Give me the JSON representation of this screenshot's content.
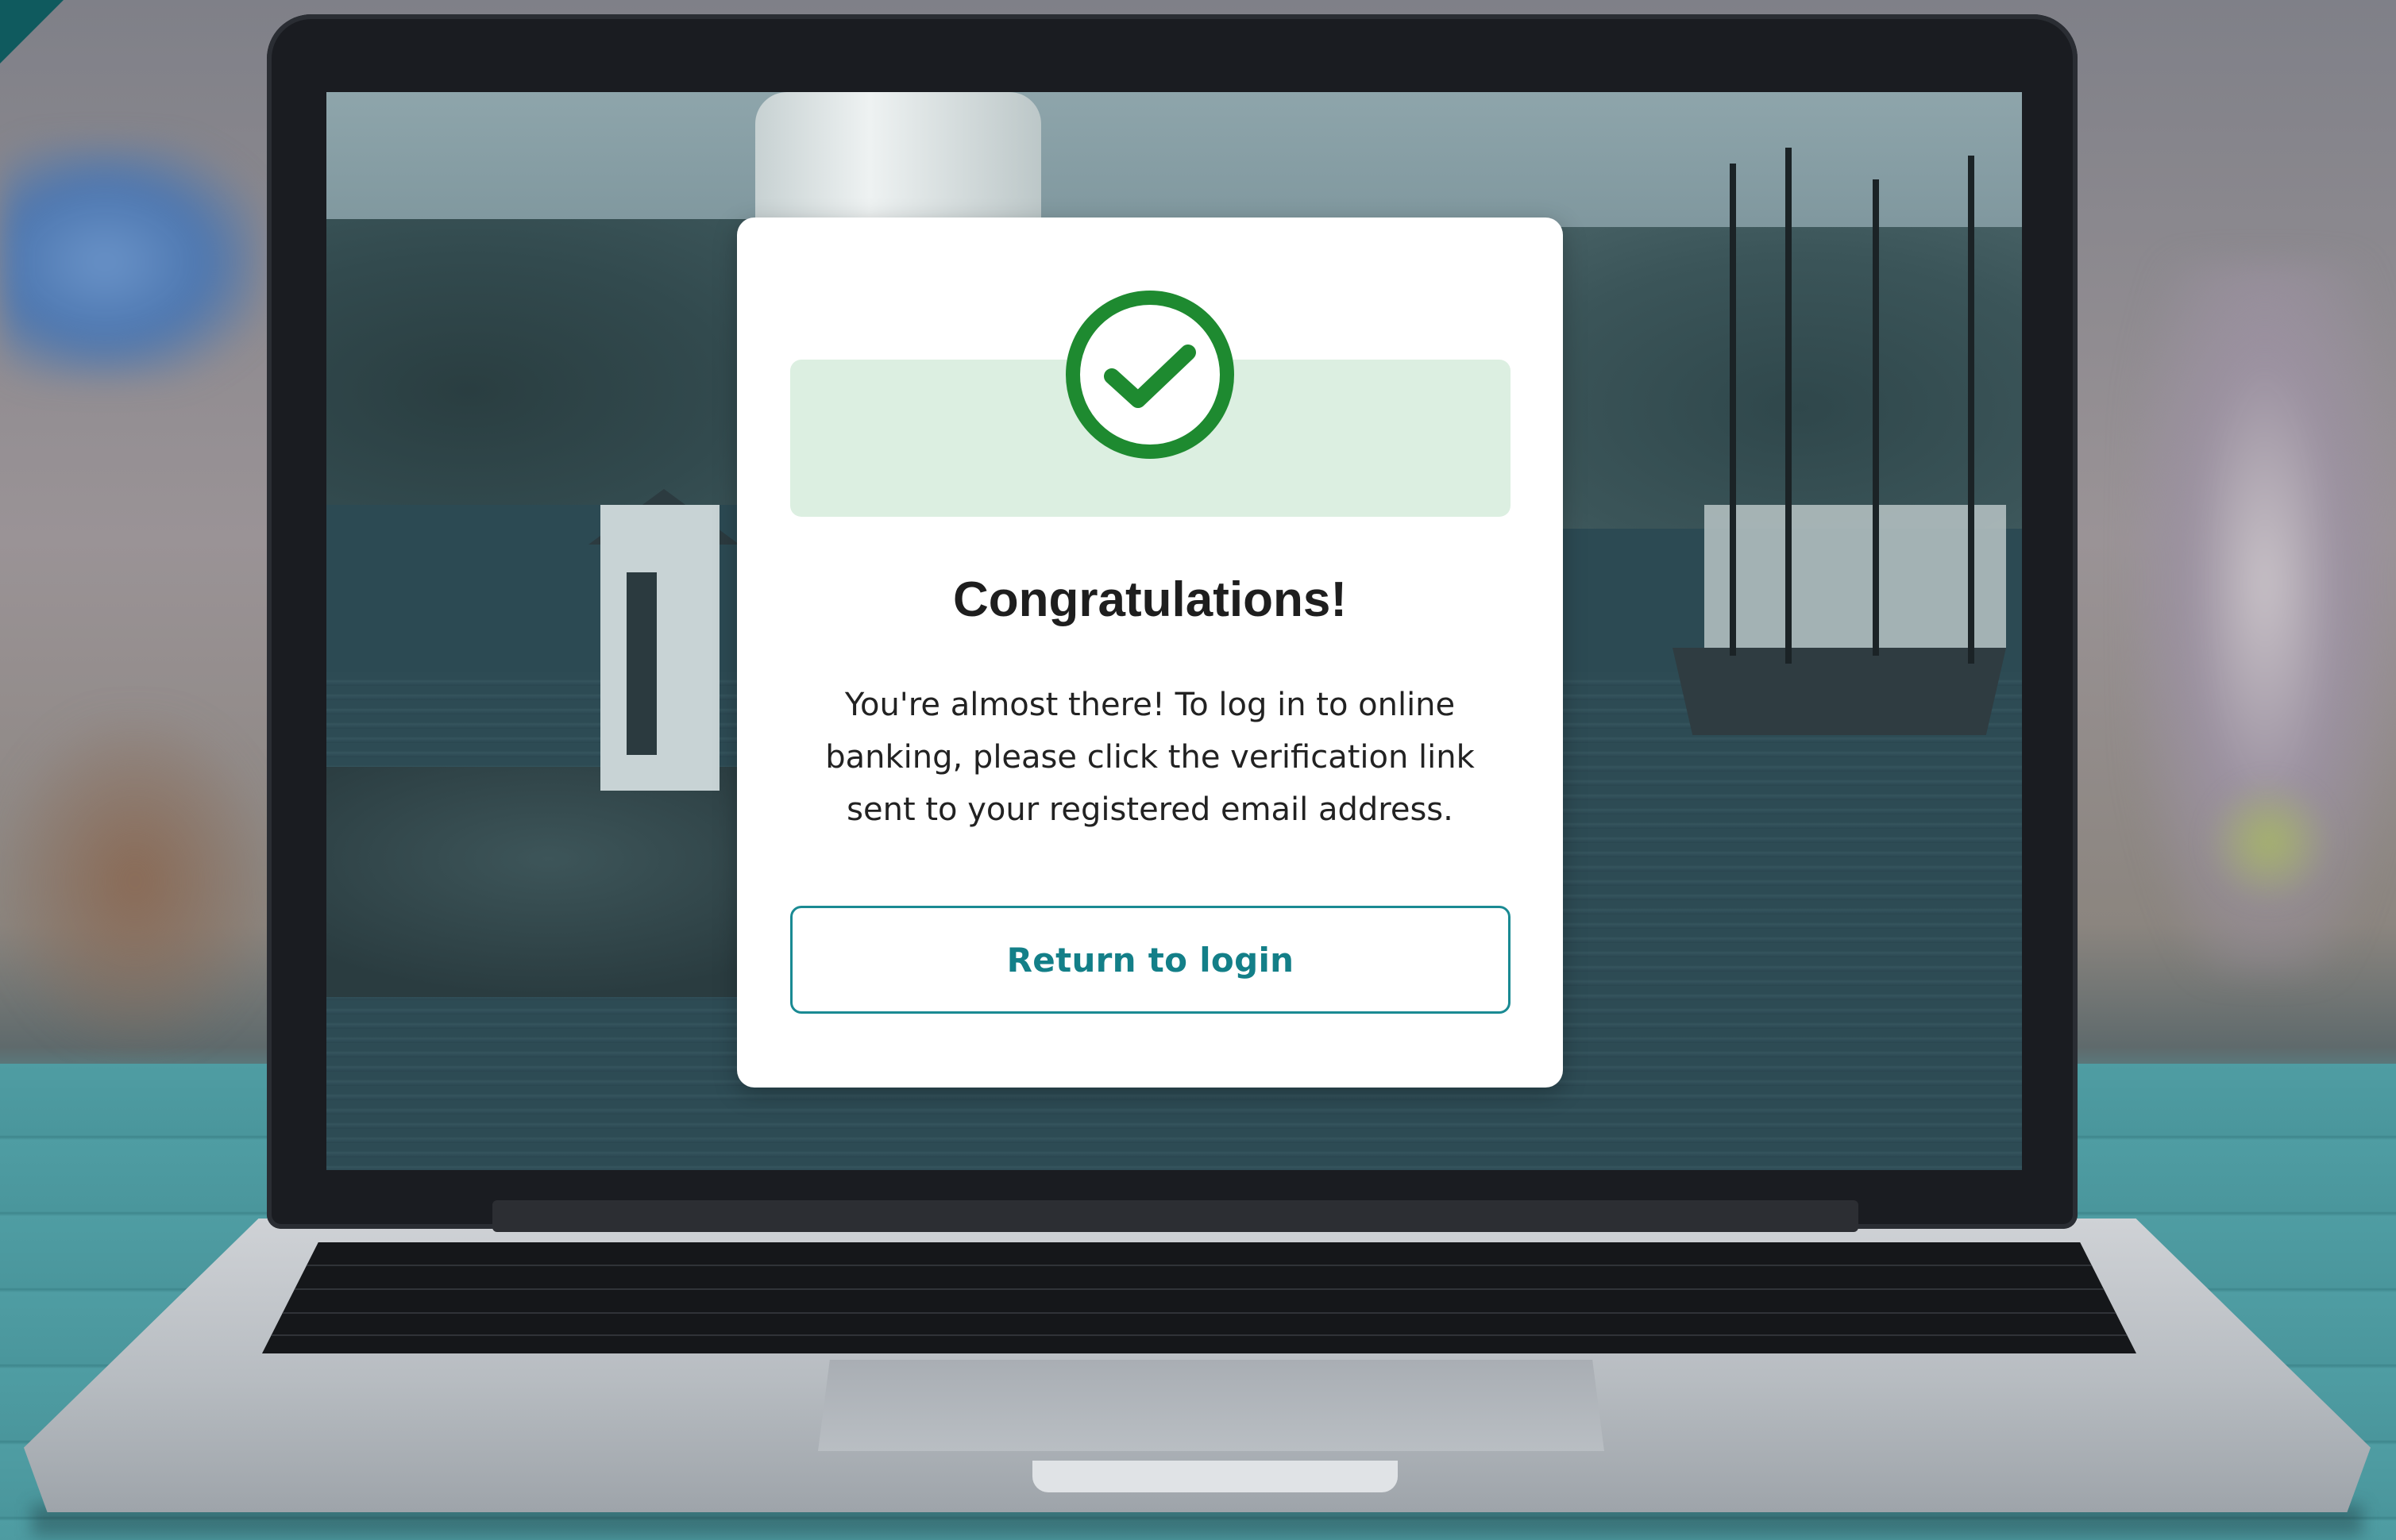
{
  "modal": {
    "title": "Congratulations!",
    "message": "You're almost there! To log in to online banking, please click the verification link sent to your registered email address.",
    "return_button_label": "Return to login",
    "icon": "check-circle-icon"
  },
  "colors": {
    "success_green": "#1e8a30",
    "success_band": "#dcefe1",
    "accent_teal": "#137f88"
  }
}
